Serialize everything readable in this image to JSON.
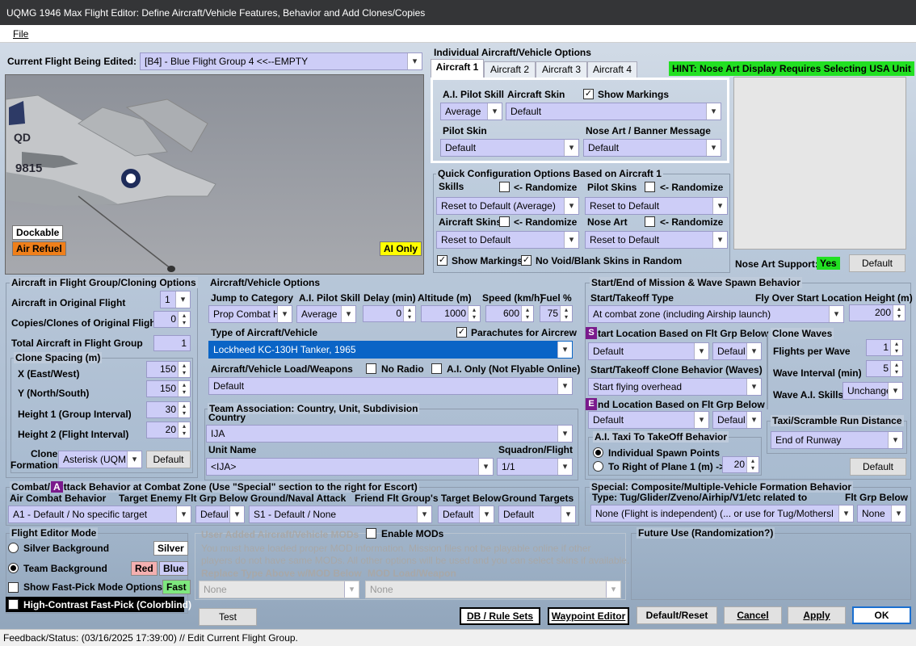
{
  "window": {
    "title": "UQMG 1946 Max Flight Editor:  Define Aircraft/Vehicle Features, Behavior and Add Clones/Copies"
  },
  "menu": {
    "file": "File"
  },
  "current_flight": {
    "label": "Current Flight Being Edited:",
    "value": "[B4] - Blue Flight Group  4     <<--EMPTY"
  },
  "preview": {
    "dockable": "Dockable",
    "air_refuel": "Air Refuel",
    "ai_only": "AI Only"
  },
  "individual": {
    "title": "Individual Aircraft/Vehicle Options",
    "tabs": [
      "Aircraft 1",
      "Aircraft 2",
      "Aircraft 3",
      "Aircraft 4"
    ],
    "hint": "HINT:  Nose Art Display Requires Selecting USA Unit",
    "ai_skill_label": "A.I. Pilot Skill",
    "ai_skill": "Average",
    "skin_label": "Aircraft Skin",
    "skin": "Default",
    "show_markings": "Show Markings",
    "show_markings_checked": "✓",
    "pilot_skin_label": "Pilot Skin",
    "pilot_skin": "Default",
    "nose_art_label": "Nose Art / Banner Message",
    "nose_art": "Default"
  },
  "quick": {
    "title": "Quick Configuration Options Based on Aircraft 1",
    "skills": "Skills",
    "pilot_skins": "Pilot Skins",
    "aircraft_skins": "Aircraft Skins",
    "nose_art": "Nose Art",
    "randomize": "<- Randomize",
    "skills_value": "Reset to Default (Average)",
    "pilot_skins_value": "Reset to Default",
    "aircraft_skins_value": "Reset to Default",
    "nose_art_value": "Reset to Default",
    "show_markings": "Show Markings",
    "no_void": "No Void/Blank Skins in Random",
    "check": "✓"
  },
  "nose_support": {
    "label": "Nose Art Support:",
    "yes": "Yes",
    "default_btn": "Default"
  },
  "group": {
    "title": "Aircraft in Flight Group/Cloning Options",
    "orig_label": "Aircraft in Original Flight",
    "orig_value": "1",
    "copies_label": "Copies/Clones of Original Flight",
    "copies_value": "0",
    "total_label": "Total Aircraft in Flight Group",
    "total_value": "1",
    "spacing_title": "Clone Spacing (m)",
    "x_label": "X (East/West)",
    "x_value": "150",
    "y_label": "Y (North/South)",
    "y_value": "150",
    "h1_label": "Height 1 (Group Interval)",
    "h1_value": "30",
    "h2_label": "Height 2 (Flight Interval)",
    "h2_value": "20",
    "formation_label1": "Clone",
    "formation_label2": "Formation",
    "formation_value": "Asterisk (UQM",
    "default_btn": "Default"
  },
  "vehicle": {
    "title": "Aircraft/Vehicle Options",
    "jump_label": "Jump to Category",
    "jump_value": "Prop Combat H",
    "skill_label": "A.I. Pilot Skill",
    "skill_value": "Average",
    "delay_label": "Delay (min)",
    "delay_value": "0",
    "alt_label": "Altitude (m)",
    "alt_value": "1000",
    "speed_label": "Speed (km/h)",
    "speed_value": "600",
    "fuel_label": "Fuel %",
    "fuel_value": "75",
    "type_label": "Type of Aircraft/Vehicle",
    "type_value": "Lockheed KC-130H Tanker, 1965",
    "parachutes": "Parachutes for Aircrew",
    "parachutes_check": "✓",
    "load_label": "Aircraft/Vehicle Load/Weapons",
    "no_radio": "No Radio",
    "ai_only": "A.I. Only (Not Flyable Online)",
    "load_value": "Default"
  },
  "team": {
    "title": "Team Association:  Country, Unit, Subdivision",
    "country_label": "Country",
    "country_value": "IJA",
    "unit_label": "Unit Name",
    "unit_value": "<IJA>",
    "squadron_label": "Squadron/Flight",
    "squadron_value": "1/1"
  },
  "spawn": {
    "title": "Start/End of Mission & Wave Spawn Behavior",
    "start_type_label": "Start/Takeoff Type",
    "start_type_value": "At combat zone (including Airship launch)",
    "flyover_label": "Fly Over Start Location Height (m)",
    "flyover_value": "200",
    "start_loc_label": "tart Location Based on Flt Grp Below",
    "start_loc_letter": "S",
    "start_loc_value": "Default",
    "start_loc_value2": "Defaul",
    "clone_beh_label": "Start/Takeoff Clone Behavior (Waves)",
    "clone_beh_value": "Start flying overhead",
    "end_loc_letter": "E",
    "end_loc_label": "nd Location Based on Flt Grp Below",
    "end_loc_value": "Default",
    "end_loc_value2": "Defaul",
    "waves_title": "Clone Waves",
    "flights_label": "Flights per Wave",
    "flights_value": "1",
    "interval_label": "Wave Interval (min)",
    "interval_value": "5",
    "wave_skill_label": "Wave A.I. Skills",
    "wave_skill_value": "Unchange",
    "taxi_title": "A.I. Taxi To TakeOff Behavior",
    "individual_spawn": "Individual Spawn Points",
    "right_of_plane": "To Right of Plane 1 (m) ->",
    "right_value": "20",
    "scramble_title": "Taxi/Scramble Run Distance",
    "scramble_value": "End of Runway",
    "default_btn": "Default"
  },
  "combat": {
    "title_pre": "Combat/",
    "title_letter": "A",
    "title_post": "ttack Behavior at Combat Zone (Use \"Special\" section to the right for Escort)",
    "air_label": "Air Combat Behavior",
    "air_value": "A1 - Default / No specific target",
    "target_label": "Target Enemy Flt Grp Below",
    "target_value": "Defaul",
    "ground_label": "Ground/Naval Attack",
    "ground_value": "S1 - Default / None",
    "friend_label": "Friend Flt Group's Target Below",
    "friend_value": "Default",
    "targets_label": "Ground Targets",
    "targets_value": "Default"
  },
  "special": {
    "title": "Special: Composite/Multiple-Vehicle Formation Behavior",
    "type_label": "Type: Tug/Glider/Zveno/Airhip/V1/etc related to",
    "flt_label": "Flt Grp Below",
    "type_value": "None (Flight is independent) (... or use for Tug/Mothersl",
    "flt_value": "None"
  },
  "mode": {
    "title": "Flight Editor Mode",
    "silver_bg": "Silver Background",
    "silver": "Silver",
    "team_bg": "Team Background",
    "red": "Red",
    "blue": "Blue",
    "fast_pick": "Show Fast-Pick Mode Options",
    "fast": "Fast",
    "high_contrast": "High-Contrast Fast-Pick (Colorblind)"
  },
  "mods": {
    "title": "User Added Aircraft/Vehicle MODs",
    "enable": "Enable MODs",
    "text1": "You must have loaded proper MOD information. Mission files not be playable online if other",
    "text2": "players do not have same MODs. All other options will be used and you can select skins if available.",
    "replace_label": "Replace Type Above w/MOD Below",
    "load_label": "MOD Load/Weapon",
    "mod_value": "None",
    "load_value": "None"
  },
  "future": {
    "title": "Future Use (Randomization?)"
  },
  "buttons": {
    "test": "Test",
    "db": "DB / Rule Sets",
    "waypoint": "Waypoint Editor",
    "default_reset": "Default/Reset",
    "cancel": "Cancel",
    "apply": "Apply",
    "ok": "OK"
  },
  "status": {
    "text": "Feedback/Status:  (03/16/2025 17:39:00) // Edit Current Flight Group."
  },
  "colors": {
    "title_bg": "#343537",
    "dropdown": "#cdcdf7",
    "hint": "#22e022",
    "air_refuel": "#ef7f1a",
    "ai_only": "#ffff00",
    "yes": "#22e022",
    "selected": "#0a64c6",
    "purple": "#7a1a8c"
  }
}
